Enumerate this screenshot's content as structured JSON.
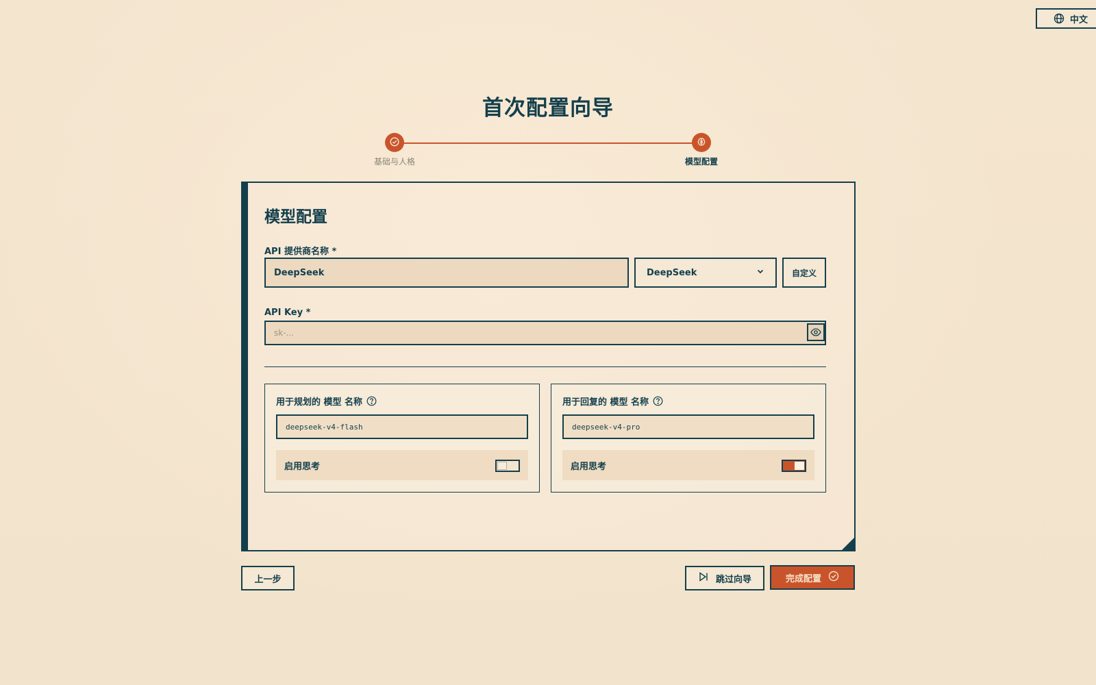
{
  "language": {
    "label": "中文",
    "icon": "globe-icon"
  },
  "wizard": {
    "title": "首次配置向导"
  },
  "steps": [
    {
      "label": "基础与人格",
      "state": "completed",
      "icon": "check-circle-icon"
    },
    {
      "label": "模型配置",
      "state": "active",
      "icon": "brain-icon"
    }
  ],
  "card": {
    "title": "模型配置",
    "provider": {
      "label": "API 提供商名称 *",
      "value": "DeepSeek",
      "select_value": "DeepSeek",
      "custom_button": "自定义"
    },
    "api_key": {
      "label": "API Key *",
      "placeholder": "sk-...",
      "value": ""
    },
    "planning_model": {
      "label": "用于规划的 模型 名称",
      "value": "deepseek-v4-flash",
      "thinking_label": "启用思考",
      "thinking_enabled": false
    },
    "reply_model": {
      "label": "用于回复的 模型 名称",
      "value": "deepseek-v4-pro",
      "thinking_label": "启用思考",
      "thinking_enabled": true
    }
  },
  "footer": {
    "prev_label": "上一步",
    "skip_label": "跳过向导",
    "finish_label": "完成配置"
  },
  "colors": {
    "background": "#f4e6d1",
    "primary": "#133f4c",
    "accent": "#c9542c"
  }
}
